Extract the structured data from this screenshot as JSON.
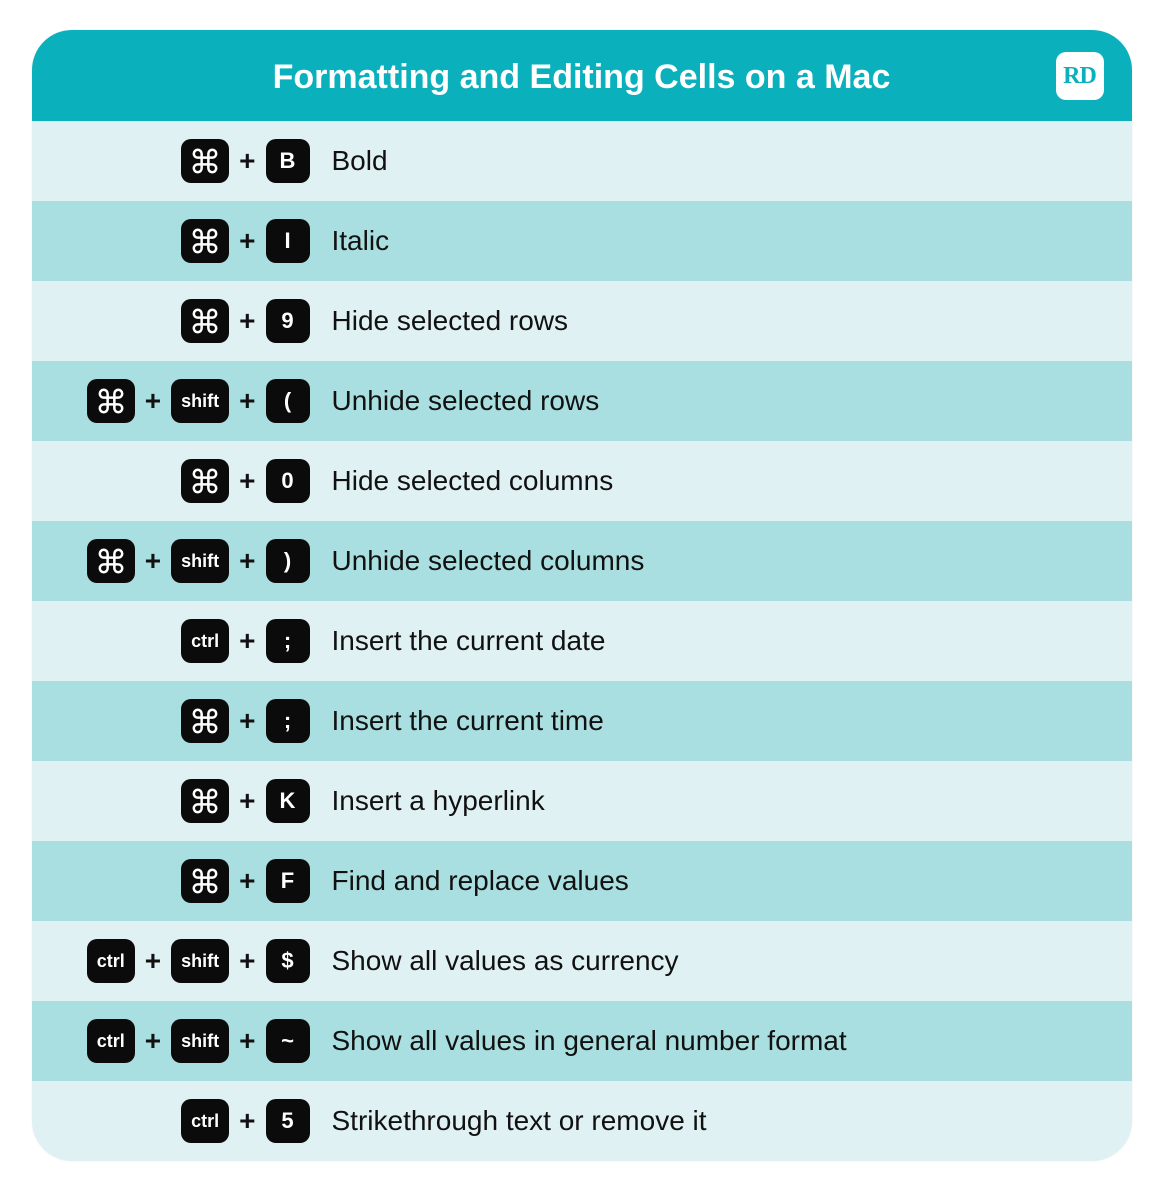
{
  "header": {
    "title": "Formatting and Editing Cells on a Mac",
    "logo_text": "RD"
  },
  "key_labels": {
    "cmd": "⌘",
    "shift": "shift",
    "ctrl": "ctrl"
  },
  "separator": "+",
  "rows": [
    {
      "keys": [
        {
          "type": "cmd"
        },
        {
          "type": "char",
          "v": "B"
        }
      ],
      "desc": "Bold"
    },
    {
      "keys": [
        {
          "type": "cmd"
        },
        {
          "type": "char",
          "v": "I"
        }
      ],
      "desc": "Italic"
    },
    {
      "keys": [
        {
          "type": "cmd"
        },
        {
          "type": "char",
          "v": "9"
        }
      ],
      "desc": "Hide selected rows"
    },
    {
      "keys": [
        {
          "type": "cmd"
        },
        {
          "type": "shift"
        },
        {
          "type": "char",
          "v": "("
        }
      ],
      "desc": "Unhide selected rows"
    },
    {
      "keys": [
        {
          "type": "cmd"
        },
        {
          "type": "char",
          "v": "0"
        }
      ],
      "desc": "Hide selected columns"
    },
    {
      "keys": [
        {
          "type": "cmd"
        },
        {
          "type": "shift"
        },
        {
          "type": "char",
          "v": ")"
        }
      ],
      "desc": "Unhide selected columns"
    },
    {
      "keys": [
        {
          "type": "ctrl"
        },
        {
          "type": "char",
          "v": ";"
        }
      ],
      "desc": "Insert the current date"
    },
    {
      "keys": [
        {
          "type": "cmd"
        },
        {
          "type": "char",
          "v": ";"
        }
      ],
      "desc": "Insert the current time"
    },
    {
      "keys": [
        {
          "type": "cmd"
        },
        {
          "type": "char",
          "v": "K"
        }
      ],
      "desc": "Insert a hyperlink"
    },
    {
      "keys": [
        {
          "type": "cmd"
        },
        {
          "type": "char",
          "v": "F"
        }
      ],
      "desc": "Find and replace values"
    },
    {
      "keys": [
        {
          "type": "ctrl"
        },
        {
          "type": "shift"
        },
        {
          "type": "char",
          "v": "$"
        }
      ],
      "desc": "Show all values as currency"
    },
    {
      "keys": [
        {
          "type": "ctrl"
        },
        {
          "type": "shift"
        },
        {
          "type": "char",
          "v": "~"
        }
      ],
      "desc": "Show all values in general number format"
    },
    {
      "keys": [
        {
          "type": "ctrl"
        },
        {
          "type": "char",
          "v": "5"
        }
      ],
      "desc": "Strikethrough text or remove it"
    }
  ]
}
